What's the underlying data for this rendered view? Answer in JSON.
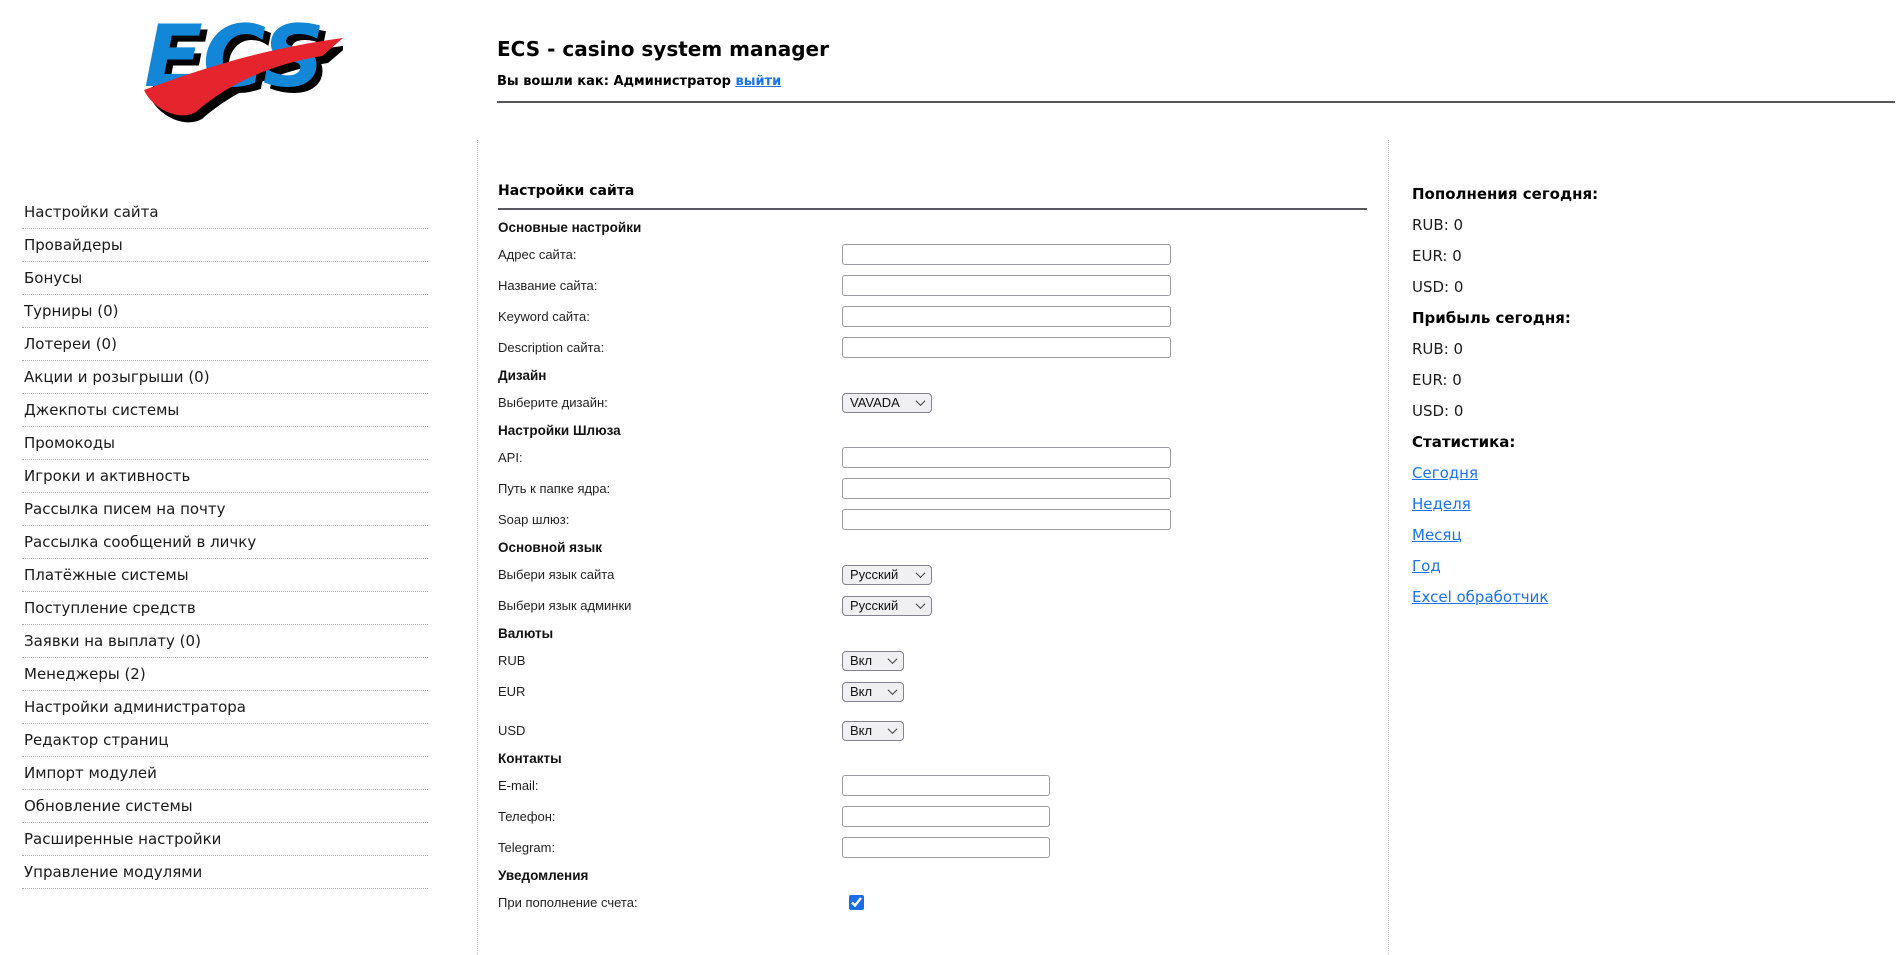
{
  "header": {
    "logo_text": "ECS",
    "title": "ECS - casino system manager",
    "logged_in_as": "Вы вошли как: Администратор",
    "logout_label": "выйти"
  },
  "sidebar": {
    "items": [
      {
        "label": "Настройки сайта"
      },
      {
        "label": "Провайдеры"
      },
      {
        "label": "Бонусы"
      },
      {
        "label": "Турниры (0)"
      },
      {
        "label": "Лотереи (0)"
      },
      {
        "label": "Акции и розыгрыши (0)"
      },
      {
        "label": "Джекпоты системы"
      },
      {
        "label": "Промокоды"
      },
      {
        "label": "Игроки и активность"
      },
      {
        "label": "Рассылка писем на почту"
      },
      {
        "label": "Рассылка сообщений в личку"
      },
      {
        "label": "Платёжные системы"
      },
      {
        "label": "Поступление средств"
      },
      {
        "label": "Заявки на выплату (0)"
      },
      {
        "label": "Менеджеры (2)"
      },
      {
        "label": "Настройки администратора"
      },
      {
        "label": "Редактор страниц"
      },
      {
        "label": "Импорт модулей"
      },
      {
        "label": "Обновление системы"
      },
      {
        "label": "Расширенные настройки"
      },
      {
        "label": "Управление модулями"
      }
    ]
  },
  "main": {
    "title": "Настройки сайта",
    "rows": [
      {
        "type": "section",
        "label": "Основные настройки"
      },
      {
        "type": "input",
        "label": "Адрес сайта:",
        "value": "",
        "w": "wide"
      },
      {
        "type": "input",
        "label": "Название сайта:",
        "value": "",
        "w": "wide"
      },
      {
        "type": "input",
        "label": "Keyword сайта:",
        "value": "",
        "w": "wide"
      },
      {
        "type": "input",
        "label": "Description сайта:",
        "value": "",
        "w": "wide"
      },
      {
        "type": "section",
        "label": "Дизайн"
      },
      {
        "type": "select",
        "label": "Выберите дизайн:",
        "value": "VAVADA",
        "w": "mid"
      },
      {
        "type": "section",
        "label": "Настройки Шлюза"
      },
      {
        "type": "input",
        "label": "API:",
        "value": "",
        "w": "wide"
      },
      {
        "type": "input",
        "label": "Путь к папке ядра:",
        "value": "",
        "w": "wide"
      },
      {
        "type": "input",
        "label": "Soap шлюз:",
        "value": "",
        "w": "wide"
      },
      {
        "type": "section",
        "label": "Основной язык"
      },
      {
        "type": "select",
        "label": "Выбери язык сайта",
        "value": "Русский",
        "w": "mid"
      },
      {
        "type": "select",
        "label": "Выбери язык админки",
        "value": "Русский",
        "w": "mid"
      },
      {
        "type": "section",
        "label": "Валюты"
      },
      {
        "type": "select",
        "label": "RUB",
        "value": "Вкл",
        "w": "small"
      },
      {
        "type": "select",
        "label": "EUR",
        "value": "Вкл",
        "w": "small",
        "gap": "lg"
      },
      {
        "type": "select",
        "label": "USD",
        "value": "Вкл",
        "w": "small",
        "gap": "xl"
      },
      {
        "type": "section",
        "label": "Контакты"
      },
      {
        "type": "input",
        "label": "E-mail:",
        "value": "",
        "w": "narrow"
      },
      {
        "type": "input",
        "label": "Телефон:",
        "value": "",
        "w": "narrow"
      },
      {
        "type": "input",
        "label": "Telegram:",
        "value": "",
        "w": "narrow"
      },
      {
        "type": "section",
        "label": "Уведомления"
      },
      {
        "type": "checkbox",
        "label": "При пополнение счета:",
        "checked": true
      }
    ]
  },
  "right_panel": {
    "lines": [
      {
        "type": "title",
        "text": "Пополнения сегодня:"
      },
      {
        "type": "stat",
        "label": "RUB:",
        "value": "0"
      },
      {
        "type": "stat",
        "label": "EUR:",
        "value": "0"
      },
      {
        "type": "stat",
        "label": "USD:",
        "value": "0"
      },
      {
        "type": "title",
        "text": "Прибыль сегодня:"
      },
      {
        "type": "stat",
        "label": "RUB:",
        "value": "0"
      },
      {
        "type": "stat",
        "label": "EUR:",
        "value": "0"
      },
      {
        "type": "stat",
        "label": "USD:",
        "value": "0"
      },
      {
        "type": "title",
        "text": "Статистика:"
      },
      {
        "type": "link",
        "text": "Сегодня"
      },
      {
        "type": "link",
        "text": "Неделя"
      },
      {
        "type": "link",
        "text": "Месяц"
      },
      {
        "type": "link",
        "text": "Год"
      },
      {
        "type": "link",
        "text": "Excel обработчик"
      }
    ]
  },
  "colors": {
    "link_blue": "#1a73e8",
    "checkbox_blue": "#1a6dea",
    "logo_blue": "#1286d7",
    "logo_red": "#e5242e"
  }
}
